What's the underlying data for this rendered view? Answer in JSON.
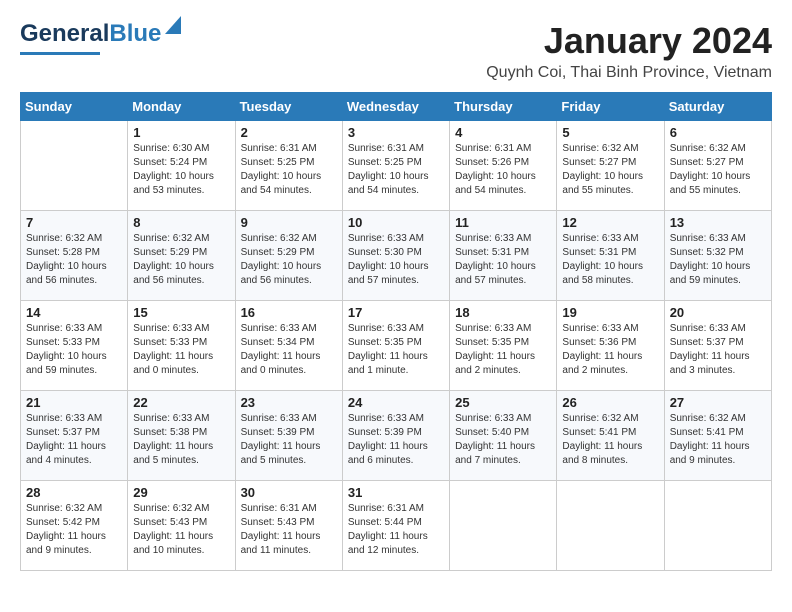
{
  "header": {
    "logo_general": "General",
    "logo_blue": "Blue",
    "month": "January 2024",
    "location": "Quynh Coi, Thai Binh Province, Vietnam"
  },
  "days_of_week": [
    "Sunday",
    "Monday",
    "Tuesday",
    "Wednesday",
    "Thursday",
    "Friday",
    "Saturday"
  ],
  "weeks": [
    [
      {
        "num": "",
        "text": ""
      },
      {
        "num": "1",
        "text": "Sunrise: 6:30 AM\nSunset: 5:24 PM\nDaylight: 10 hours\nand 53 minutes."
      },
      {
        "num": "2",
        "text": "Sunrise: 6:31 AM\nSunset: 5:25 PM\nDaylight: 10 hours\nand 54 minutes."
      },
      {
        "num": "3",
        "text": "Sunrise: 6:31 AM\nSunset: 5:25 PM\nDaylight: 10 hours\nand 54 minutes."
      },
      {
        "num": "4",
        "text": "Sunrise: 6:31 AM\nSunset: 5:26 PM\nDaylight: 10 hours\nand 54 minutes."
      },
      {
        "num": "5",
        "text": "Sunrise: 6:32 AM\nSunset: 5:27 PM\nDaylight: 10 hours\nand 55 minutes."
      },
      {
        "num": "6",
        "text": "Sunrise: 6:32 AM\nSunset: 5:27 PM\nDaylight: 10 hours\nand 55 minutes."
      }
    ],
    [
      {
        "num": "7",
        "text": "Sunrise: 6:32 AM\nSunset: 5:28 PM\nDaylight: 10 hours\nand 56 minutes."
      },
      {
        "num": "8",
        "text": "Sunrise: 6:32 AM\nSunset: 5:29 PM\nDaylight: 10 hours\nand 56 minutes."
      },
      {
        "num": "9",
        "text": "Sunrise: 6:32 AM\nSunset: 5:29 PM\nDaylight: 10 hours\nand 56 minutes."
      },
      {
        "num": "10",
        "text": "Sunrise: 6:33 AM\nSunset: 5:30 PM\nDaylight: 10 hours\nand 57 minutes."
      },
      {
        "num": "11",
        "text": "Sunrise: 6:33 AM\nSunset: 5:31 PM\nDaylight: 10 hours\nand 57 minutes."
      },
      {
        "num": "12",
        "text": "Sunrise: 6:33 AM\nSunset: 5:31 PM\nDaylight: 10 hours\nand 58 minutes."
      },
      {
        "num": "13",
        "text": "Sunrise: 6:33 AM\nSunset: 5:32 PM\nDaylight: 10 hours\nand 59 minutes."
      }
    ],
    [
      {
        "num": "14",
        "text": "Sunrise: 6:33 AM\nSunset: 5:33 PM\nDaylight: 10 hours\nand 59 minutes."
      },
      {
        "num": "15",
        "text": "Sunrise: 6:33 AM\nSunset: 5:33 PM\nDaylight: 11 hours\nand 0 minutes."
      },
      {
        "num": "16",
        "text": "Sunrise: 6:33 AM\nSunset: 5:34 PM\nDaylight: 11 hours\nand 0 minutes."
      },
      {
        "num": "17",
        "text": "Sunrise: 6:33 AM\nSunset: 5:35 PM\nDaylight: 11 hours\nand 1 minute."
      },
      {
        "num": "18",
        "text": "Sunrise: 6:33 AM\nSunset: 5:35 PM\nDaylight: 11 hours\nand 2 minutes."
      },
      {
        "num": "19",
        "text": "Sunrise: 6:33 AM\nSunset: 5:36 PM\nDaylight: 11 hours\nand 2 minutes."
      },
      {
        "num": "20",
        "text": "Sunrise: 6:33 AM\nSunset: 5:37 PM\nDaylight: 11 hours\nand 3 minutes."
      }
    ],
    [
      {
        "num": "21",
        "text": "Sunrise: 6:33 AM\nSunset: 5:37 PM\nDaylight: 11 hours\nand 4 minutes."
      },
      {
        "num": "22",
        "text": "Sunrise: 6:33 AM\nSunset: 5:38 PM\nDaylight: 11 hours\nand 5 minutes."
      },
      {
        "num": "23",
        "text": "Sunrise: 6:33 AM\nSunset: 5:39 PM\nDaylight: 11 hours\nand 5 minutes."
      },
      {
        "num": "24",
        "text": "Sunrise: 6:33 AM\nSunset: 5:39 PM\nDaylight: 11 hours\nand 6 minutes."
      },
      {
        "num": "25",
        "text": "Sunrise: 6:33 AM\nSunset: 5:40 PM\nDaylight: 11 hours\nand 7 minutes."
      },
      {
        "num": "26",
        "text": "Sunrise: 6:32 AM\nSunset: 5:41 PM\nDaylight: 11 hours\nand 8 minutes."
      },
      {
        "num": "27",
        "text": "Sunrise: 6:32 AM\nSunset: 5:41 PM\nDaylight: 11 hours\nand 9 minutes."
      }
    ],
    [
      {
        "num": "28",
        "text": "Sunrise: 6:32 AM\nSunset: 5:42 PM\nDaylight: 11 hours\nand 9 minutes."
      },
      {
        "num": "29",
        "text": "Sunrise: 6:32 AM\nSunset: 5:43 PM\nDaylight: 11 hours\nand 10 minutes."
      },
      {
        "num": "30",
        "text": "Sunrise: 6:31 AM\nSunset: 5:43 PM\nDaylight: 11 hours\nand 11 minutes."
      },
      {
        "num": "31",
        "text": "Sunrise: 6:31 AM\nSunset: 5:44 PM\nDaylight: 11 hours\nand 12 minutes."
      },
      {
        "num": "",
        "text": ""
      },
      {
        "num": "",
        "text": ""
      },
      {
        "num": "",
        "text": ""
      }
    ]
  ]
}
